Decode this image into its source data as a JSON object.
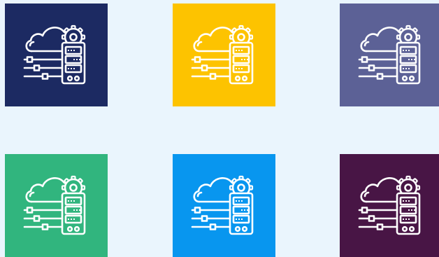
{
  "icon_name": "cloud-server-settings-icon",
  "tiles": [
    {
      "color": "#1c2a62"
    },
    {
      "color": "#fdc300"
    },
    {
      "color": "#5c6196"
    },
    {
      "color": "#31b57e"
    },
    {
      "color": "#0896ef"
    },
    {
      "color": "#481545"
    }
  ],
  "icon_stroke": "#ffffff"
}
